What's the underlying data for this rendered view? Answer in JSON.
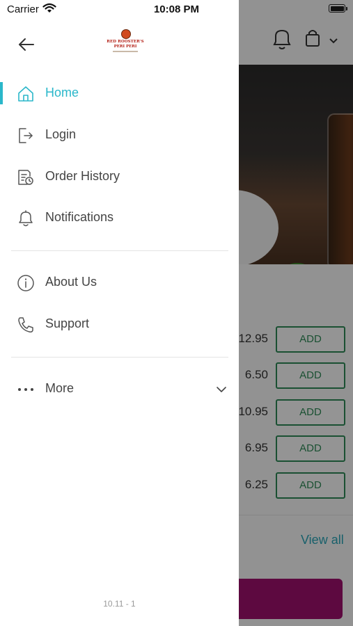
{
  "status_bar": {
    "carrier": "Carrier",
    "time": "10:08 PM"
  },
  "drawer": {
    "logo": {
      "line1": "RED ROOSTER'S",
      "line2": "PERI PERI"
    },
    "menu": [
      {
        "label": "Home",
        "icon": "home-icon",
        "active": true
      },
      {
        "label": "Login",
        "icon": "login-icon",
        "active": false
      },
      {
        "label": "Order History",
        "icon": "order-history-icon",
        "active": false
      },
      {
        "label": "Notifications",
        "icon": "bell-icon",
        "active": false
      },
      {
        "label": "About Us",
        "icon": "info-icon",
        "active": false
      },
      {
        "label": "Support",
        "icon": "phone-icon",
        "active": false
      },
      {
        "label": "More",
        "icon": "more-dots-icon",
        "active": false
      }
    ],
    "version": "10.11 - 1"
  },
  "background": {
    "items": [
      {
        "price": "12.95",
        "action": "ADD"
      },
      {
        "price": "6.50",
        "action": "ADD"
      },
      {
        "price": "10.95",
        "action": "ADD"
      },
      {
        "price": "6.95",
        "action": "ADD"
      },
      {
        "price": "6.25",
        "action": "ADD"
      }
    ],
    "view_all": "View all"
  },
  "colors": {
    "accent": "#2ab7ca",
    "add_button": "#2e8b57",
    "cta": "#a0116e"
  }
}
